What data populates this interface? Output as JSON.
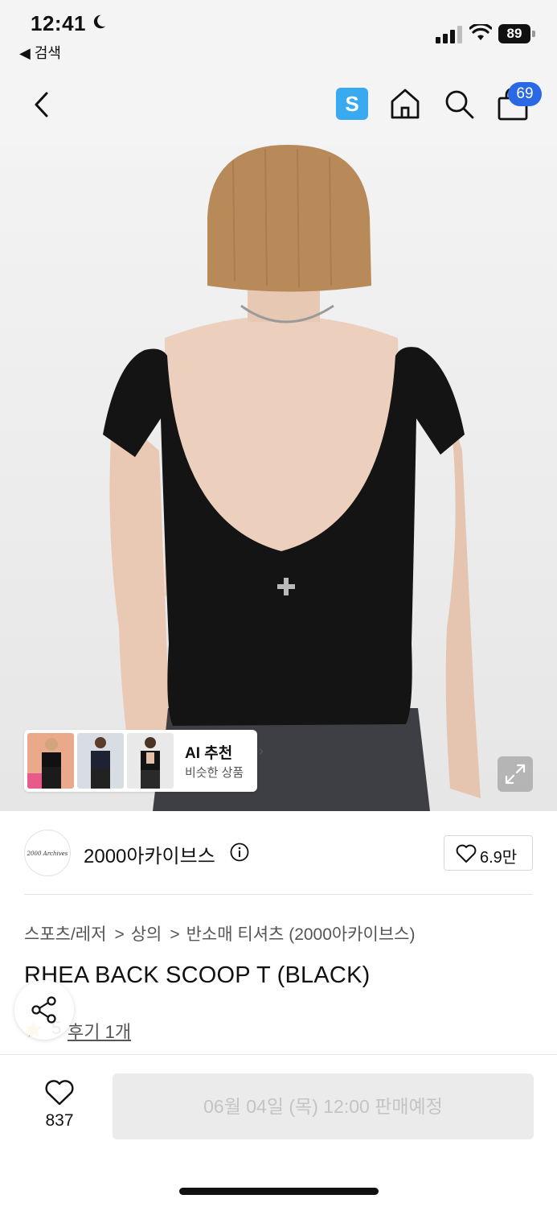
{
  "status_bar": {
    "time": "12:41",
    "back_app": "◀ 검색",
    "battery": "89"
  },
  "nav": {
    "store_badge_letter": "S",
    "cart_count": "69"
  },
  "ai_recommend": {
    "title": "AI 추천",
    "subtitle": "비슷한 상품"
  },
  "brand": {
    "logo_text": "2000 Archives",
    "name": "2000아카이브스",
    "like_count": "6.9만"
  },
  "breadcrumb": [
    "스포츠/레저",
    "상의",
    "반소매 티셔츠 (2000아카이브스)"
  ],
  "product": {
    "title": "RHEA BACK SCOOP T (BLACK)",
    "rating": "5",
    "review_link": "후기 1개"
  },
  "bottom_bar": {
    "wish_count": "837",
    "sale_button": "06월 04일 (목) 12:00 판매예정"
  },
  "colors": {
    "accent_blue": "#2a68e6",
    "store_badge": "#3aaaf0",
    "star": "#f5a623"
  },
  "icons": [
    "moon-icon",
    "signal-icon",
    "wifi-icon",
    "battery-icon",
    "back-chevron-icon",
    "home-icon",
    "search-icon",
    "shopping-bag-icon",
    "expand-icon",
    "info-icon",
    "heart-icon",
    "star-icon",
    "share-icon"
  ]
}
